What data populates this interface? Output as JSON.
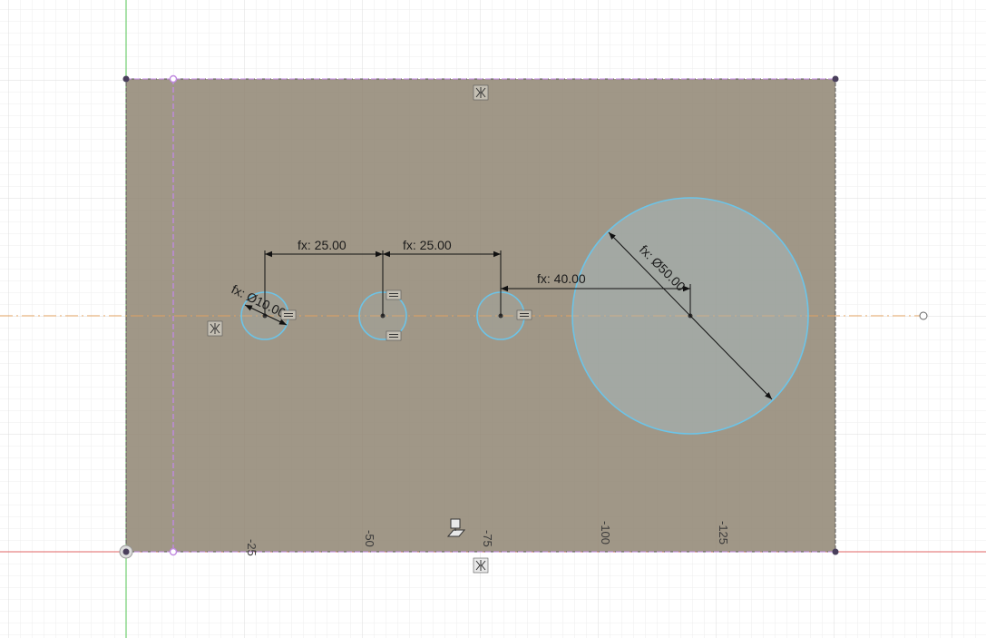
{
  "colors": {
    "background": "#ffffff",
    "grid_minor": "#eeeeee",
    "grid_major": "#dcdcdc",
    "profile_fill": "#8f8572",
    "circle_stroke": "#6cc4e8",
    "circle_fill": "#a9c9d6",
    "dimension_line": "#111111",
    "centerline": "#e0a060",
    "x_axis": "#e06666",
    "y_axis": "#55c455",
    "construction": "#c089e0",
    "point": "#4a3f5c"
  },
  "dimensions": {
    "d1": "fx: 25.00",
    "d2": "fx: 25.00",
    "d3": "fx: 40.00",
    "dia_small": "fx: Ø10.00",
    "dia_large": "fx: Ø50.00"
  },
  "ruler_labels": [
    "-25",
    "-50",
    "-75",
    "-100",
    "-125"
  ],
  "icons": {
    "symmetric_top": "symmetric-constraint-icon",
    "symmetric_left": "symmetric-constraint-icon",
    "symmetric_bottom": "symmetric-constraint-icon",
    "equal_1": "equal-constraint-icon",
    "equal_2": "equal-constraint-icon",
    "equal_3": "equal-constraint-icon",
    "equal_4": "equal-constraint-icon",
    "midpoint": "midpoint-constraint-icon"
  }
}
